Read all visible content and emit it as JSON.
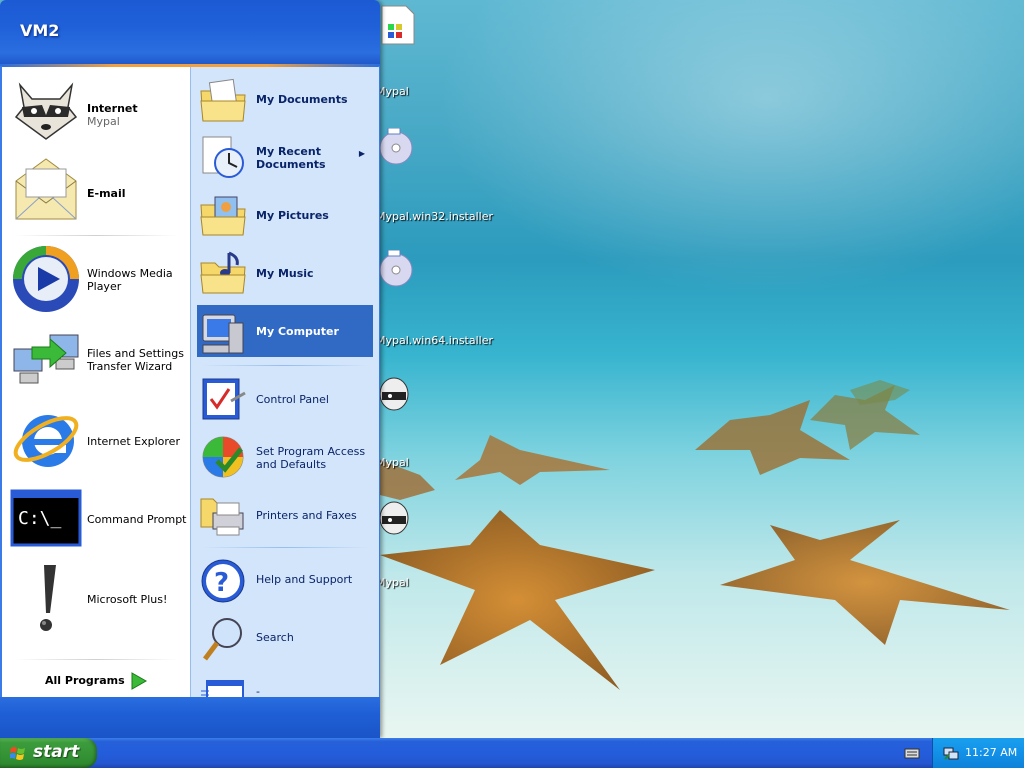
{
  "desktop": {
    "icons": [
      {
        "label": "Mypal",
        "icon": "document-icon"
      },
      {
        "label": "Mypal.win32.installer",
        "icon": "cd-icon"
      },
      {
        "label": "Mypal.win64.installer",
        "icon": "cd-icon"
      },
      {
        "label": "Mypal",
        "icon": "raccoon-icon"
      },
      {
        "label": "Mypal",
        "icon": "raccoon-icon"
      }
    ]
  },
  "start_menu": {
    "user_name": "VM2",
    "pinned": [
      {
        "title": "Internet",
        "subtitle": "Mypal",
        "icon": "raccoon-icon"
      },
      {
        "title": "E-mail",
        "icon": "envelope-icon"
      }
    ],
    "recent": [
      {
        "title": "Windows Media",
        "title2": "Player",
        "icon": "media-player-icon"
      },
      {
        "title": "Files and Settings",
        "title2": "Transfer Wizard",
        "icon": "transfer-wizard-icon"
      },
      {
        "title": "Internet Explorer",
        "icon": "internet-explorer-icon"
      },
      {
        "title": "Command Prompt",
        "icon": "command-prompt-icon"
      },
      {
        "title": "Microsoft Plus!",
        "icon": "exclamation-icon"
      }
    ],
    "all_programs": "All Programs",
    "places": [
      {
        "title": "My Documents",
        "icon": "folder-documents-icon"
      },
      {
        "title": "My Recent",
        "title2": "Documents",
        "icon": "recent-documents-icon"
      },
      {
        "title": "My Pictures",
        "icon": "folder-pictures-icon"
      },
      {
        "title": "My Music",
        "icon": "folder-music-icon"
      },
      {
        "title": "My Computer",
        "icon": "computer-icon",
        "selected": true
      }
    ],
    "tools": [
      {
        "title": "Control Panel",
        "icon": "control-panel-icon"
      },
      {
        "title": "Set Program Access",
        "title2": "and Defaults",
        "icon": "program-access-icon"
      },
      {
        "title": "Printers and Faxes",
        "icon": "printer-icon"
      }
    ],
    "help": [
      {
        "title": "Help and Support",
        "icon": "help-icon"
      },
      {
        "title": "Search",
        "icon": "search-icon"
      },
      {
        "title": "-",
        "icon": "run-icon"
      }
    ]
  },
  "taskbar": {
    "start_label": "start",
    "clock": "11:27 AM"
  },
  "colors": {
    "taskbar_blue": "#245ddb",
    "start_green": "#369436",
    "selection": "#316ac5",
    "right_pane": "#d3e5fa"
  }
}
